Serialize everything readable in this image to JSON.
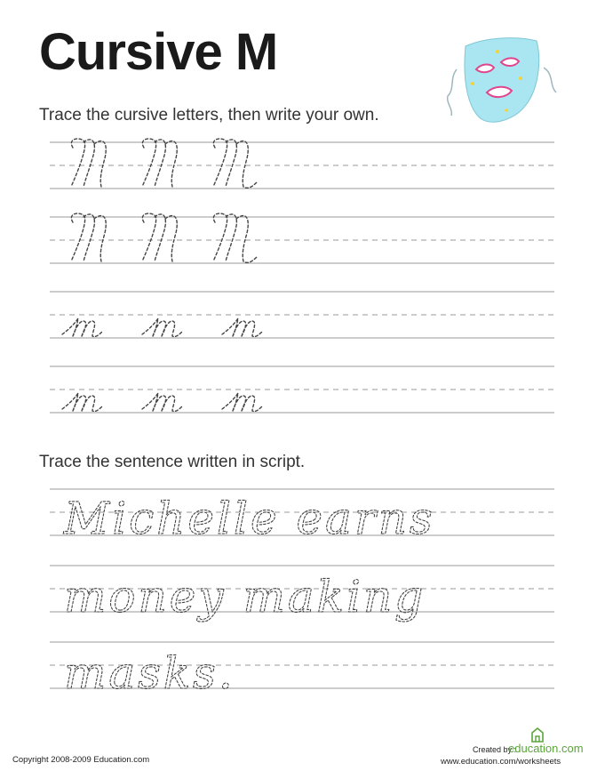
{
  "title": "Cursive M",
  "instructions": {
    "letters": "Trace the cursive letters, then write your own.",
    "sentence": "Trace the sentence written in script."
  },
  "tracing": {
    "upper_m": "M",
    "lower_m": "m",
    "sentence_line1": "Michelle earns",
    "sentence_line2": "money making",
    "sentence_line3": "masks."
  },
  "footer": {
    "copyright": "Copyright 2008-2009 Education.com",
    "created_by": "Created by :",
    "brand_name": "education",
    "brand_tld": ".com",
    "url": "www.education.com/worksheets"
  },
  "colors": {
    "brand_green": "#5aa43a",
    "mask_face": "#a9e6f2",
    "mask_accent": "#e0468e"
  },
  "icons": [
    "theater-mask-icon",
    "education-logo-icon"
  ]
}
